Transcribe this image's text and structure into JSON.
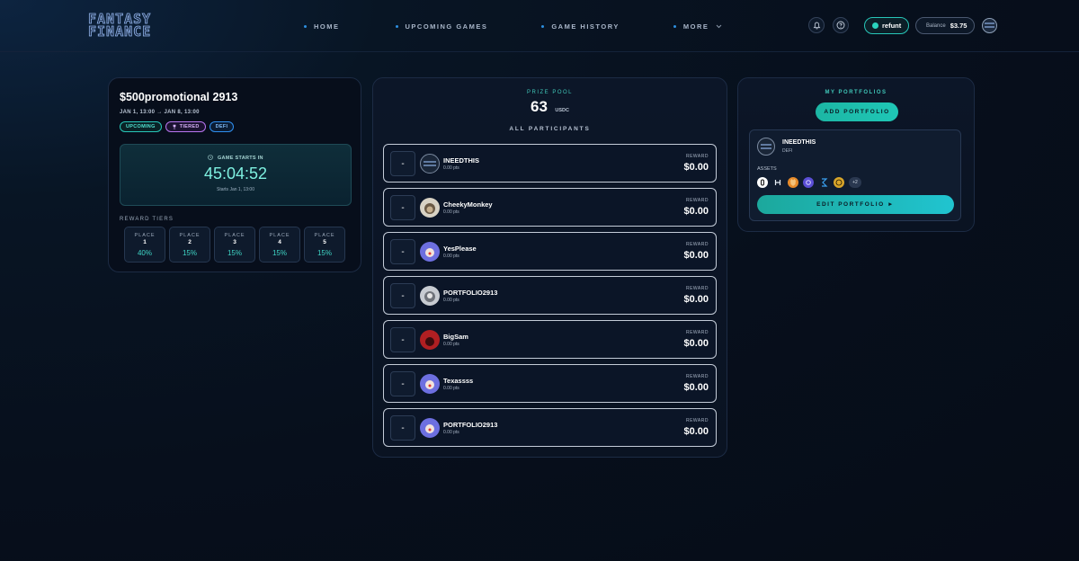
{
  "header": {
    "logo_line1": "FANTASY",
    "logo_line2": "FINANCE",
    "nav": [
      {
        "label": "HOME"
      },
      {
        "label": "UPCOMING GAMES"
      },
      {
        "label": "GAME HISTORY"
      },
      {
        "label": "MORE"
      }
    ],
    "refunt_label": "refunt",
    "balance_label": "Balance",
    "balance_value": "$3.75"
  },
  "game": {
    "title": "$500promotional 2913",
    "date_range": "JAN 1, 13:00 → JAN 8, 13:00",
    "tags": [
      "UPCOMING",
      "TIERED",
      "DEFI"
    ],
    "countdown_label": "GAME STARTS IN",
    "countdown_time": "45:04:52",
    "countdown_sub": "Starts Jan 1, 13:00",
    "tiers_label": "REWARD TIERS",
    "tiers": [
      {
        "label": "PLACE",
        "place": "1",
        "pct": "40%"
      },
      {
        "label": "PLACE",
        "place": "2",
        "pct": "15%"
      },
      {
        "label": "PLACE",
        "place": "3",
        "pct": "15%"
      },
      {
        "label": "PLACE",
        "place": "4",
        "pct": "15%"
      },
      {
        "label": "PLACE",
        "place": "5",
        "pct": "15%"
      }
    ]
  },
  "prize": {
    "label": "PRIZE POOL",
    "value": "63",
    "currency": "USDC",
    "participants_label": "ALL PARTICIPANTS"
  },
  "participants": [
    {
      "rank": "-",
      "name": "INEEDTHIS",
      "pts": "0.00 pts",
      "reward_label": "REWARD",
      "reward": "$0.00"
    },
    {
      "rank": "-",
      "name": "CheekyMonkey",
      "pts": "0.00 pts",
      "reward_label": "REWARD",
      "reward": "$0.00"
    },
    {
      "rank": "-",
      "name": "YesPlease",
      "pts": "0.00 pts",
      "reward_label": "REWARD",
      "reward": "$0.00"
    },
    {
      "rank": "-",
      "name": "PORTFOLIO2913",
      "pts": "0.00 pts",
      "reward_label": "REWARD",
      "reward": "$0.00"
    },
    {
      "rank": "-",
      "name": "BigSam",
      "pts": "0.00 pts",
      "reward_label": "REWARD",
      "reward": "$0.00"
    },
    {
      "rank": "-",
      "name": "Texassss",
      "pts": "0.00 pts",
      "reward_label": "REWARD",
      "reward": "$0.00"
    },
    {
      "rank": "-",
      "name": "PORTFOLIO2913",
      "pts": "0.00 pts",
      "reward_label": "REWARD",
      "reward": "$0.00"
    }
  ],
  "portfolios": {
    "label": "MY PORTFOLIOS",
    "add_label": "ADD PORTFOLIO",
    "card": {
      "name": "INEEDTHIS",
      "type": "DEFI",
      "assets_label": "ASSETS",
      "more": "+2",
      "edit_label": "EDIT PORTFOLIO ►"
    }
  },
  "colors": {
    "accent_teal": "#1fc7b6",
    "tag_purple": "#b876f0",
    "tag_blue": "#2f8ff0",
    "background": "#070f1c"
  }
}
